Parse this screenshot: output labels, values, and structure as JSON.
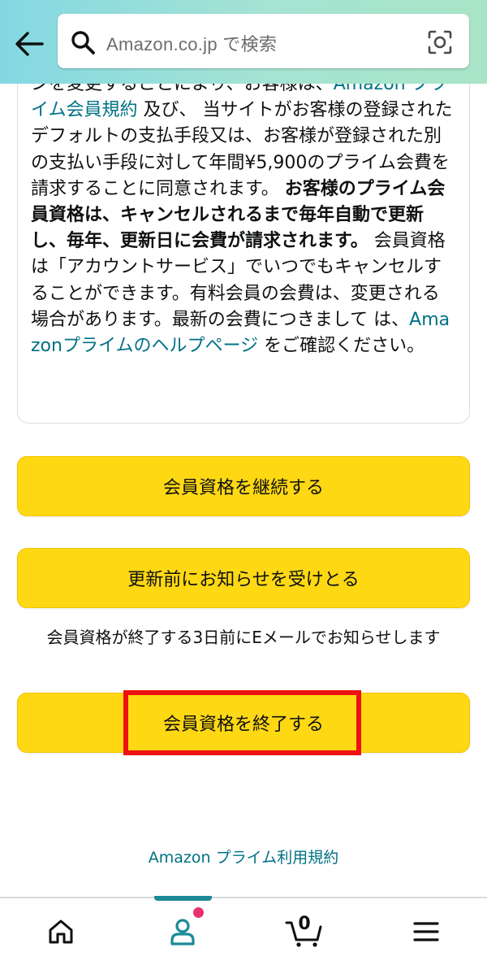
{
  "header": {
    "search_placeholder": "Amazon.co.jp で検索"
  },
  "terms": {
    "part1": "ンを変更することにより、お客様は、",
    "link_membership_terms": "Amazon プライム会員規約",
    "part2": " 及び、 当サイトがお客様の登録されたデフォルトの支払手段又は、お客様が登録された別の支払い手段に対して年間¥5,900のプライム会費を請求することに同意されます。 ",
    "bold_auto_renew": "お客様のプライム会員資格は、キャンセルされるまで毎年自動で更新し、毎年、更新日に会費が請求されます。",
    "part3": " 会員資格は「アカウントサービス」でいつでもキャンセルすることができます。有料会員の会費は、変更される場合があります。最新の会費につきまして は、",
    "link_help_page": "Amazonプライムのヘルプページ",
    "part4": " をご確認ください。"
  },
  "buttons": {
    "continue_label": "会員資格を継続する",
    "remind_label": "更新前にお知らせを受けとる",
    "remind_note": "会員資格が終了する3日前にEメールでお知らせします",
    "end_label": "会員資格を終了する"
  },
  "footer": {
    "terms_link": "Amazon プライム利用規約"
  },
  "bottom_nav": {
    "cart_count": "0",
    "items": [
      "home-icon",
      "account-icon",
      "cart-icon",
      "menu-icon"
    ]
  },
  "colors": {
    "accent_link": "#007185",
    "button_yellow": "#ffd814",
    "highlight_red": "#ee1111",
    "nav_indicator": "#1c8a96",
    "notification_dot": "#e8336e"
  }
}
